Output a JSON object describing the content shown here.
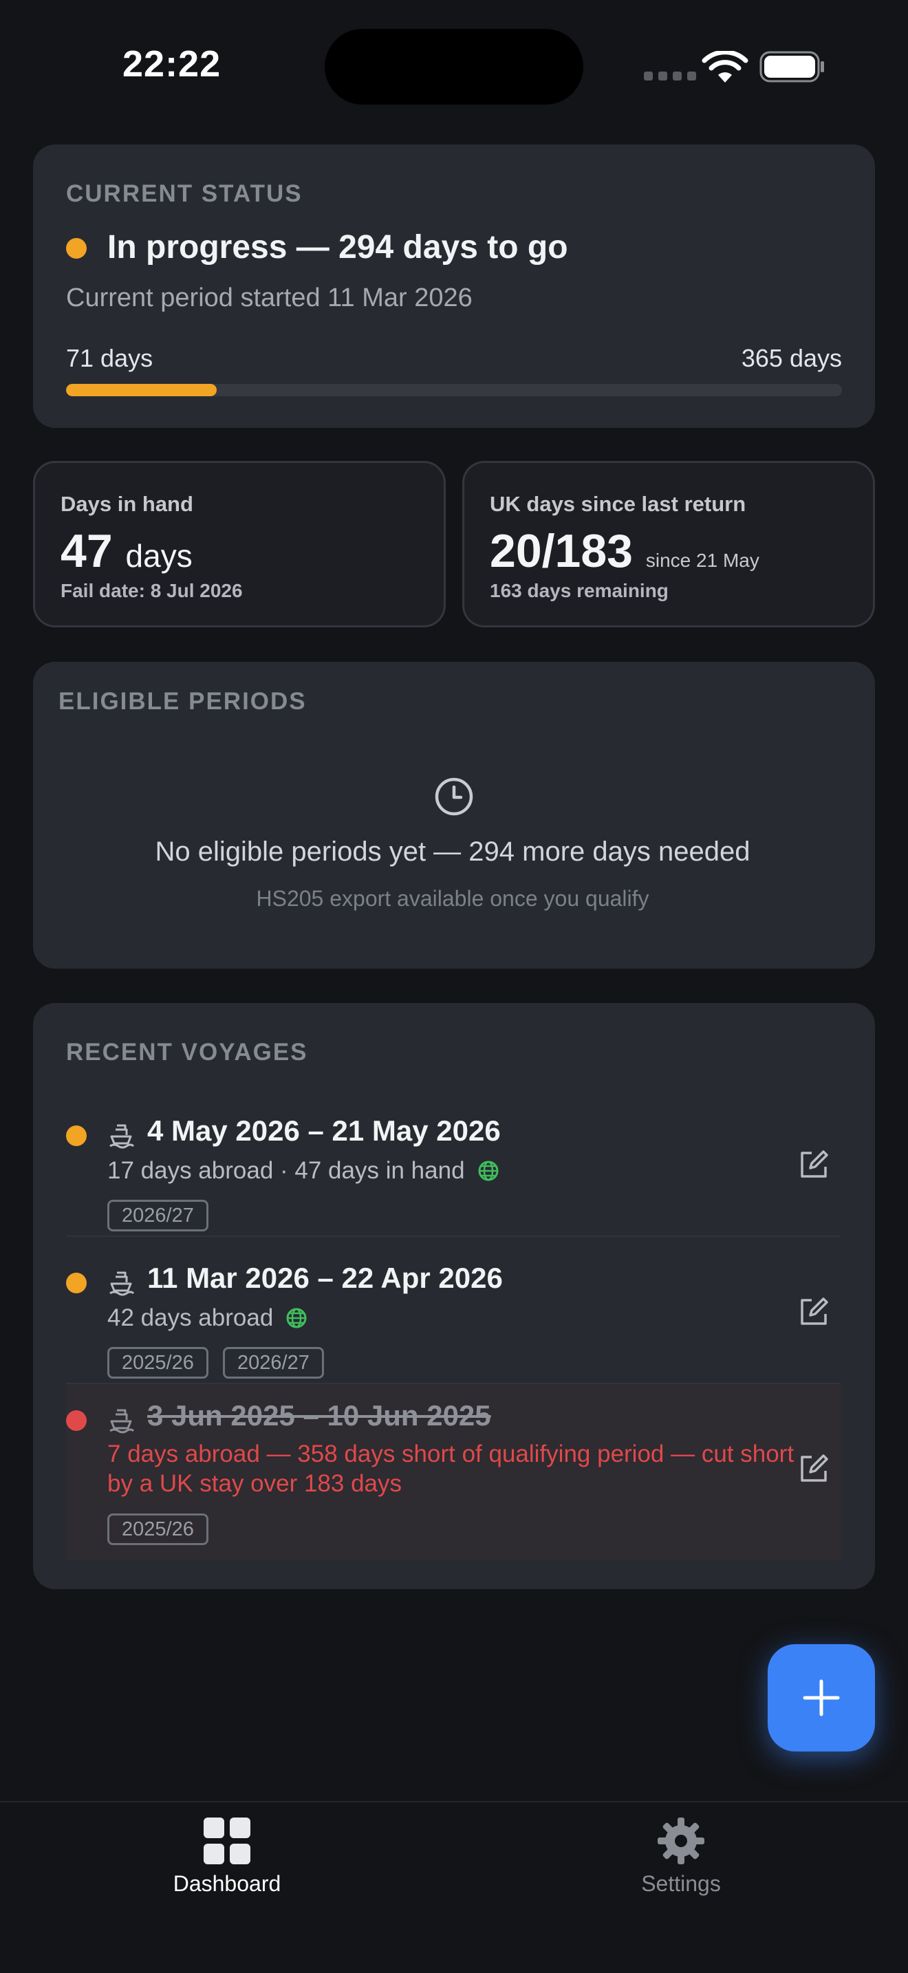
{
  "status_bar": {
    "time": "22:22"
  },
  "current_status": {
    "section_label": "CURRENT STATUS",
    "title": "In progress — 294 days to go",
    "subtitle": "Current period started 11 Mar 2026",
    "progress_start_label": "71 days",
    "progress_end_label": "365 days",
    "progress_fraction": 0.1945,
    "accent": "#f2a424"
  },
  "days_in_hand": {
    "label": "Days in hand",
    "value": "47",
    "unit": "days",
    "footer": "Fail date: 8 Jul 2026"
  },
  "uk_days": {
    "label": "UK days since last return",
    "value": "20/183",
    "since": "since 21 May",
    "footer": "163 days remaining"
  },
  "eligible_periods": {
    "section_label": "ELIGIBLE PERIODS",
    "icon": "clock-icon",
    "empty_title": "No eligible periods yet — 294 more days needed",
    "empty_subtitle": "HS205 export available once you qualify"
  },
  "recent_voyages": {
    "section_label": "RECENT VOYAGES",
    "items": [
      {
        "status_color": "#f2a424",
        "dates": "4 May 2026 – 21 May 2026",
        "detail": "17 days abroad · 47 days in hand",
        "tags": [
          "2026/27"
        ],
        "strikethrough": false
      },
      {
        "status_color": "#f2a424",
        "dates": "11 Mar 2026 – 22 Apr 2026",
        "detail": "42 days abroad",
        "tags": [
          "2025/26",
          "2026/27"
        ],
        "strikethrough": false
      },
      {
        "status_color": "#e0494a",
        "dates": "3 Jun 2025 – 10 Jun 2025",
        "detail": "7 days abroad — 358 days short of qualifying period — cut short by a UK stay over 183 days",
        "tags": [
          "2025/26"
        ],
        "strikethrough": true
      }
    ]
  },
  "fab": {
    "icon": "plus-icon",
    "color": "#3b82f6"
  },
  "tab_bar": {
    "tabs": [
      {
        "label": "Dashboard",
        "icon": "grid-icon",
        "active": true
      },
      {
        "label": "Settings",
        "icon": "gear-icon",
        "active": false
      }
    ]
  }
}
